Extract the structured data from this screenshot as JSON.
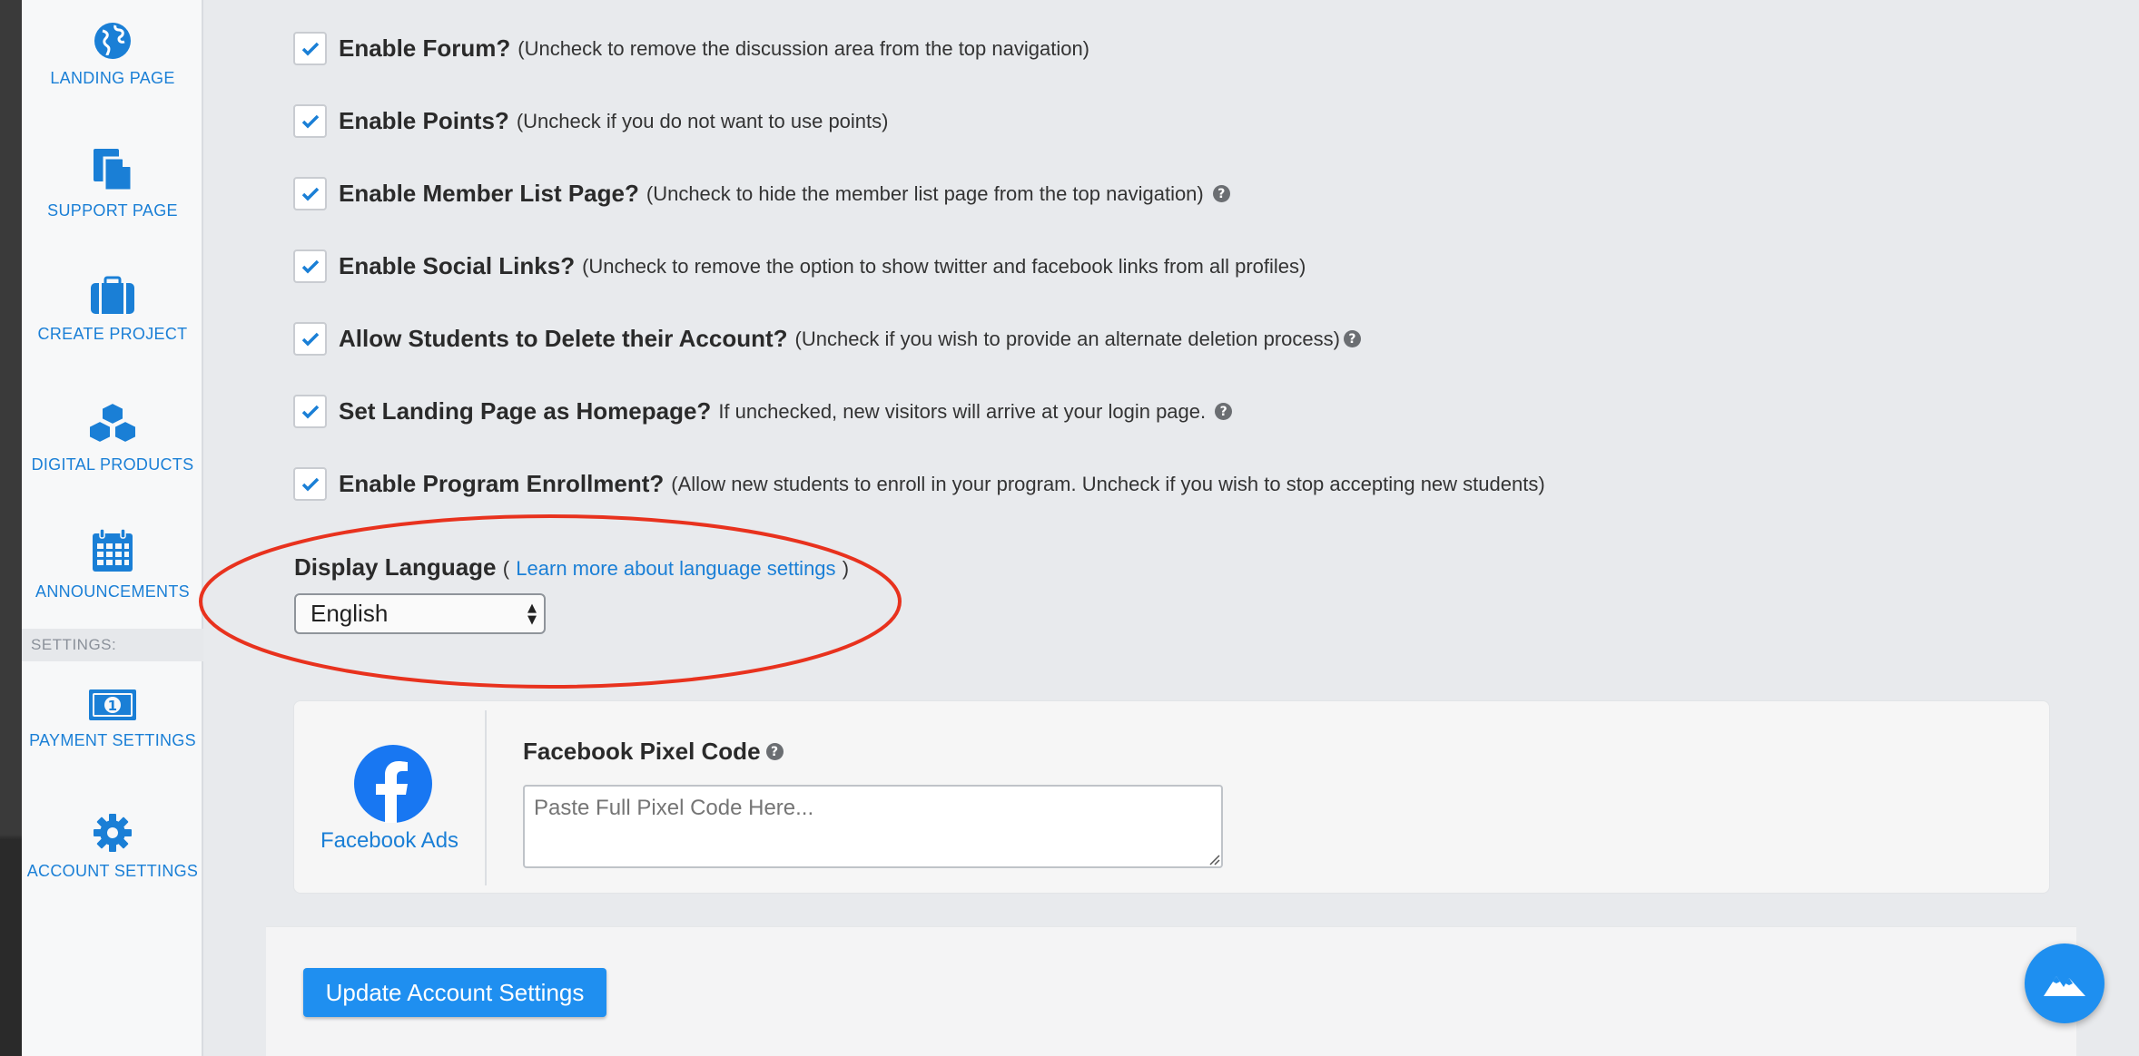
{
  "sidebar": {
    "items": [
      {
        "label": "LANDING PAGE",
        "icon": "globe-icon"
      },
      {
        "label": "SUPPORT PAGE",
        "icon": "document-icon"
      },
      {
        "label": "CREATE PROJECT",
        "icon": "briefcase-icon"
      },
      {
        "label": "DIGITAL PRODUCTS",
        "icon": "boxes-icon"
      },
      {
        "label": "ANNOUNCEMENTS",
        "icon": "calendar-icon"
      }
    ],
    "settings_header": "SETTINGS:",
    "settings_items": [
      {
        "label": "PAYMENT SETTINGS",
        "icon": "money-icon"
      },
      {
        "label": "ACCOUNT SETTINGS",
        "icon": "gear-icon"
      }
    ]
  },
  "options": [
    {
      "title": "Enable Forum?",
      "desc": "(Uncheck to remove the discussion area from the top navigation)",
      "checked": true,
      "help": false
    },
    {
      "title": "Enable Points?",
      "desc": "(Uncheck if you do not want to use points)",
      "checked": true,
      "help": false
    },
    {
      "title": "Enable Member List Page?",
      "desc": "(Uncheck to hide the member list page from the top navigation)",
      "checked": true,
      "help": true
    },
    {
      "title": "Enable Social Links?",
      "desc": "(Uncheck to remove the option to show twitter and facebook links from all profiles)",
      "checked": true,
      "help": false
    },
    {
      "title": "Allow Students to Delete their Account?",
      "desc": "(Uncheck if you wish to provide an alternate deletion process)",
      "checked": true,
      "help": true
    },
    {
      "title": "Set Landing Page as Homepage?",
      "desc": "If unchecked, new visitors will arrive at your login page.",
      "checked": true,
      "help": true
    },
    {
      "title": "Enable Program Enrollment?",
      "desc": "(Allow new students to enroll in your program. Uncheck if you wish to stop accepting new students)",
      "checked": true,
      "help": false
    }
  ],
  "help_glyph": "?",
  "language": {
    "label": "Display Language",
    "paren_open": "(",
    "link": "Learn more about language settings",
    "paren_close": ")",
    "selected": "English"
  },
  "facebook": {
    "name": "Facebook Ads",
    "title": "Facebook Pixel Code",
    "placeholder": "Paste Full Pixel Code Here...",
    "brand_color": "#1877f2"
  },
  "update_button": "Update Account Settings",
  "colors": {
    "accent": "#1a7fd6",
    "button": "#1f8ff0",
    "annotation_circle": "#e8321e"
  }
}
